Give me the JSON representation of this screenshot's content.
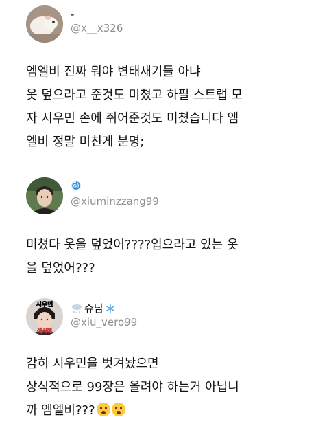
{
  "tweets": [
    {
      "name": "-",
      "handle": "@x__x326",
      "avatar_icon": "hamster-avatar-icon",
      "lines": [
        "엠엘비 진짜 뭐야 변태새기들 아냐",
        "옷 덮으라고 준것도 미쳤고 하필 스트랩 모",
        "자 시우민 손에 쥐어준것도 미쳤습니다 엠",
        "엘비 정말 미친게 분명;"
      ]
    },
    {
      "name_icon": "swirl-icon",
      "handle": "@xiuminzzang99",
      "avatar_icon": "person-avatar-icon",
      "lines": [
        "미쳤다 옷을 덮었어????입으라고 있는 옷",
        "을 덮었어???"
      ]
    },
    {
      "name": "슈님",
      "name_icons": [
        "snow-cloud-icon",
        "snowflake-icon"
      ],
      "handle": "@xiu_vero99",
      "avatar_icon": "xiumin-avatar-icon",
      "avatar_text_top": "시우민",
      "avatar_text_bottom": "섹시해",
      "lines": [
        "감히 시우민을 벗겨놨으면",
        "상식적으로 99장은 올려야 하는거 아닙니",
        "까 엠엘비???"
      ],
      "trailing_emoji": "astonished-face-icon"
    }
  ]
}
